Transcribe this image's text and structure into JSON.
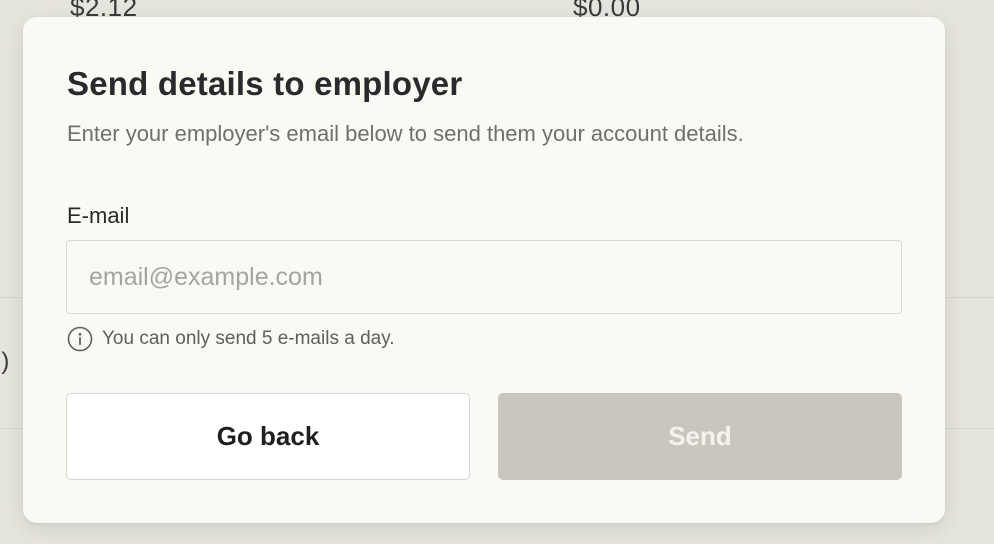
{
  "background": {
    "amount_left": "$2.12",
    "amount_right": "$0.00",
    "fragment_text": "l)"
  },
  "modal": {
    "title": "Send details to employer",
    "subtitle": "Enter your employer's email below to send them your account details.",
    "email_label": "E-mail",
    "email_value": "",
    "email_placeholder": "email@example.com",
    "hint_icon": "info-circle-icon",
    "hint_text": "You can only send 5 e-mails a day.",
    "back_button_label": "Go back",
    "send_button_label": "Send",
    "send_button_state": "disabled"
  },
  "colors": {
    "page_background": "#e6e5dd",
    "modal_background": "#fafaf4",
    "send_button_disabled": "#c9c6bf",
    "title_text": "#2a2a2c",
    "placeholder_text": "#a4a4a0"
  }
}
